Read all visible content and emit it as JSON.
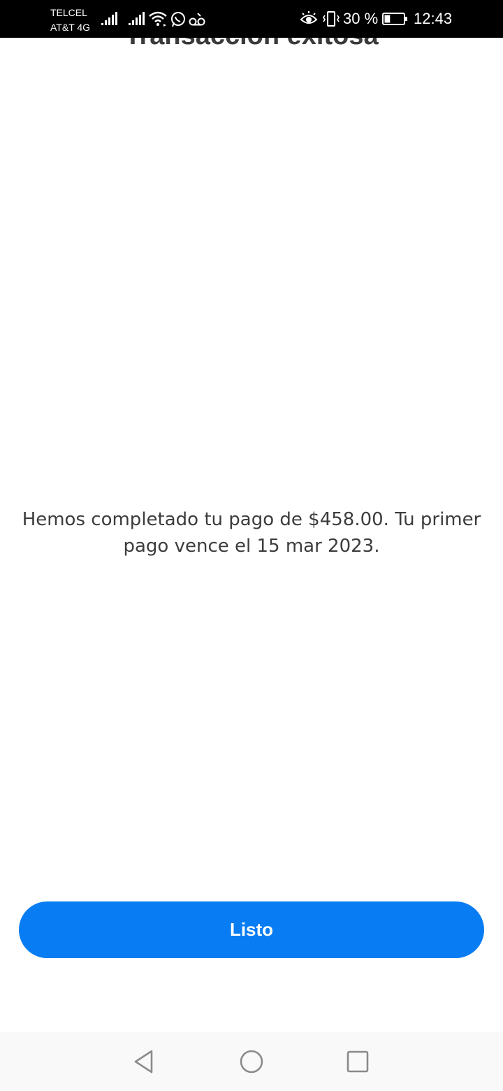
{
  "status_bar": {
    "carrier_1": "TELCEL",
    "carrier_2": "AT&T 4G",
    "battery_percent": "30 %",
    "time": "12:43",
    "icons": [
      "signal-icon",
      "signal-icon",
      "wifi-icon",
      "whatsapp-icon",
      "voicemail-icon",
      "eye-comfort-icon",
      "vibrate-icon",
      "battery-icon"
    ],
    "battery_level": 0.3
  },
  "page": {
    "title": "Transacción exitosa",
    "message": "Hemos completado tu pago de $458.00. Tu primer pago vence el 15 mar 2023."
  },
  "actions": {
    "done_label": "Listo"
  },
  "nav_bar": {
    "icons": [
      "back-icon",
      "home-icon",
      "recents-icon"
    ]
  },
  "colors": {
    "accent": "#087cf2",
    "text": "#3c3c3c",
    "status_bar": "#000000",
    "nav_bar": "#f9f9f9"
  }
}
